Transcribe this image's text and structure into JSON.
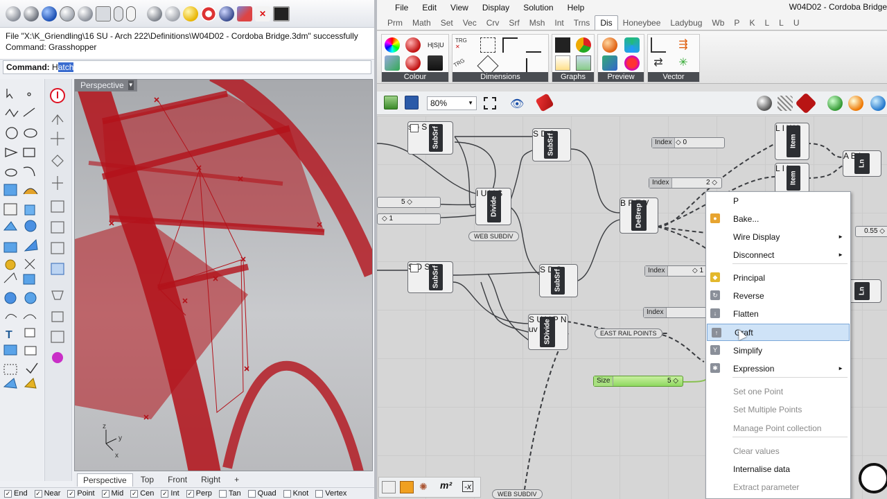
{
  "rhino": {
    "command_history": [
      "File \"X:\\K_Griendling\\16 SU - Arch 222\\Definitions\\W04D02 - Cordoba Bridge.3dm\" successfully",
      "Command: Grasshopper"
    ],
    "command_prompt_label": "Command:",
    "command_prompt_typed": "H",
    "command_prompt_selected": "atch",
    "viewport_title": "Perspective",
    "viewport_tabs": [
      "Perspective",
      "Top",
      "Front",
      "Right"
    ],
    "viewport_tab_add": "+",
    "axis_labels": {
      "z": "z",
      "y": "y",
      "x": "x"
    },
    "osnaps": [
      "End",
      "Near",
      "Point",
      "Mid",
      "Cen",
      "Int",
      "Perp",
      "Tan",
      "Quad",
      "Knot",
      "Vertex"
    ],
    "osnap_checked": [
      true,
      true,
      true,
      true,
      true,
      true,
      true,
      false,
      false,
      false,
      false
    ]
  },
  "grasshopper": {
    "title": "W04D02 - Cordoba Bridge",
    "menus": [
      "File",
      "Edit",
      "View",
      "Display",
      "Solution",
      "Help"
    ],
    "tabs": [
      "Prm",
      "Math",
      "Set",
      "Vec",
      "Crv",
      "Srf",
      "Msh",
      "Int",
      "Trns",
      "Dis",
      "Honeybee",
      "Ladybug",
      "Wb",
      "P",
      "K",
      "L",
      "L",
      "U"
    ],
    "active_tab": "Dis",
    "ribbon_panels": [
      "Colour",
      "Dimensions",
      "Graphs",
      "Preview",
      "Vector"
    ],
    "ribbon_icon_text": {
      "hsv": "H|S|U",
      "trg1": "TRG",
      "trg2": "TRG"
    },
    "zoom": "80%",
    "components": {
      "subsrf_1": "SubSrf",
      "subsrf_2": "SubSrf",
      "subsrf_3": "SubSrf",
      "subsrf_4": "SubSrf",
      "divide": "Divide",
      "sdivide": "SDivide",
      "debrep": "DeBrep",
      "item_1": "Item",
      "item_2": "Item",
      "ln_1": "Ln",
      "ln_2": "Ln"
    },
    "ports": {
      "s": "S",
      "d": "D",
      "i": "I",
      "u": "U",
      "v": "V",
      "b": "B",
      "f": "F",
      "e": "E",
      "l": "L",
      "w": "W",
      "i2": "i",
      "a": "A",
      "n": "N",
      "p": "P",
      "uv": "uv"
    },
    "sliders": [
      {
        "label": "Index",
        "value": "◇ 0"
      },
      {
        "label": "Index",
        "value": "2 ◇"
      },
      {
        "label": "",
        "value": "5 ◇"
      },
      {
        "label": "",
        "value": "◇ 1"
      },
      {
        "label": "Index",
        "value": "◇ 1"
      },
      {
        "label": "Index",
        "value": ""
      },
      {
        "label": "Size",
        "value": "5 ◇"
      },
      {
        "label": "",
        "value": "0.55 ◇"
      }
    ],
    "group_labels": [
      "WEB SUBDIV",
      "EAST RAIL POINTS",
      "WEB SUBDIV"
    ],
    "bottom_toolbar": {
      "m2": "m²",
      "x": "-x"
    },
    "context_menu": [
      {
        "label": "P",
        "enabled": true,
        "submenu": false,
        "icon": ""
      },
      {
        "label": "Bake...",
        "enabled": true,
        "submenu": false,
        "icon": "bake-icon"
      },
      {
        "label": "Wire Display",
        "enabled": true,
        "submenu": true,
        "icon": ""
      },
      {
        "label": "Disconnect",
        "enabled": true,
        "submenu": true,
        "icon": ""
      },
      {
        "label": "Principal",
        "enabled": true,
        "submenu": false,
        "icon": "principal-icon"
      },
      {
        "label": "Reverse",
        "enabled": true,
        "submenu": false,
        "icon": "reverse-icon"
      },
      {
        "label": "Flatten",
        "enabled": true,
        "submenu": false,
        "icon": "flatten-icon"
      },
      {
        "label": "Graft",
        "enabled": true,
        "submenu": false,
        "icon": "graft-icon"
      },
      {
        "label": "Simplify",
        "enabled": true,
        "submenu": false,
        "icon": "simplify-icon"
      },
      {
        "label": "Expression",
        "enabled": true,
        "submenu": true,
        "icon": "expression-icon"
      },
      {
        "label": "Set one Point",
        "enabled": false,
        "submenu": false,
        "icon": ""
      },
      {
        "label": "Set Multiple Points",
        "enabled": false,
        "submenu": false,
        "icon": ""
      },
      {
        "label": "Manage Point collection",
        "enabled": false,
        "submenu": false,
        "icon": ""
      },
      {
        "label": "Clear values",
        "enabled": false,
        "submenu": false,
        "icon": ""
      },
      {
        "label": "Internalise data",
        "enabled": true,
        "submenu": false,
        "icon": ""
      },
      {
        "label": "Extract parameter",
        "enabled": false,
        "submenu": false,
        "icon": ""
      }
    ],
    "highlighted_item": "Graft",
    "submenu_arrow": "►"
  },
  "colors": {
    "model_red": "#b3121a",
    "selection_blue": "#3a6ccf",
    "gh_canvas": "#d6d6d6",
    "component_dark": "#2d2f33"
  }
}
